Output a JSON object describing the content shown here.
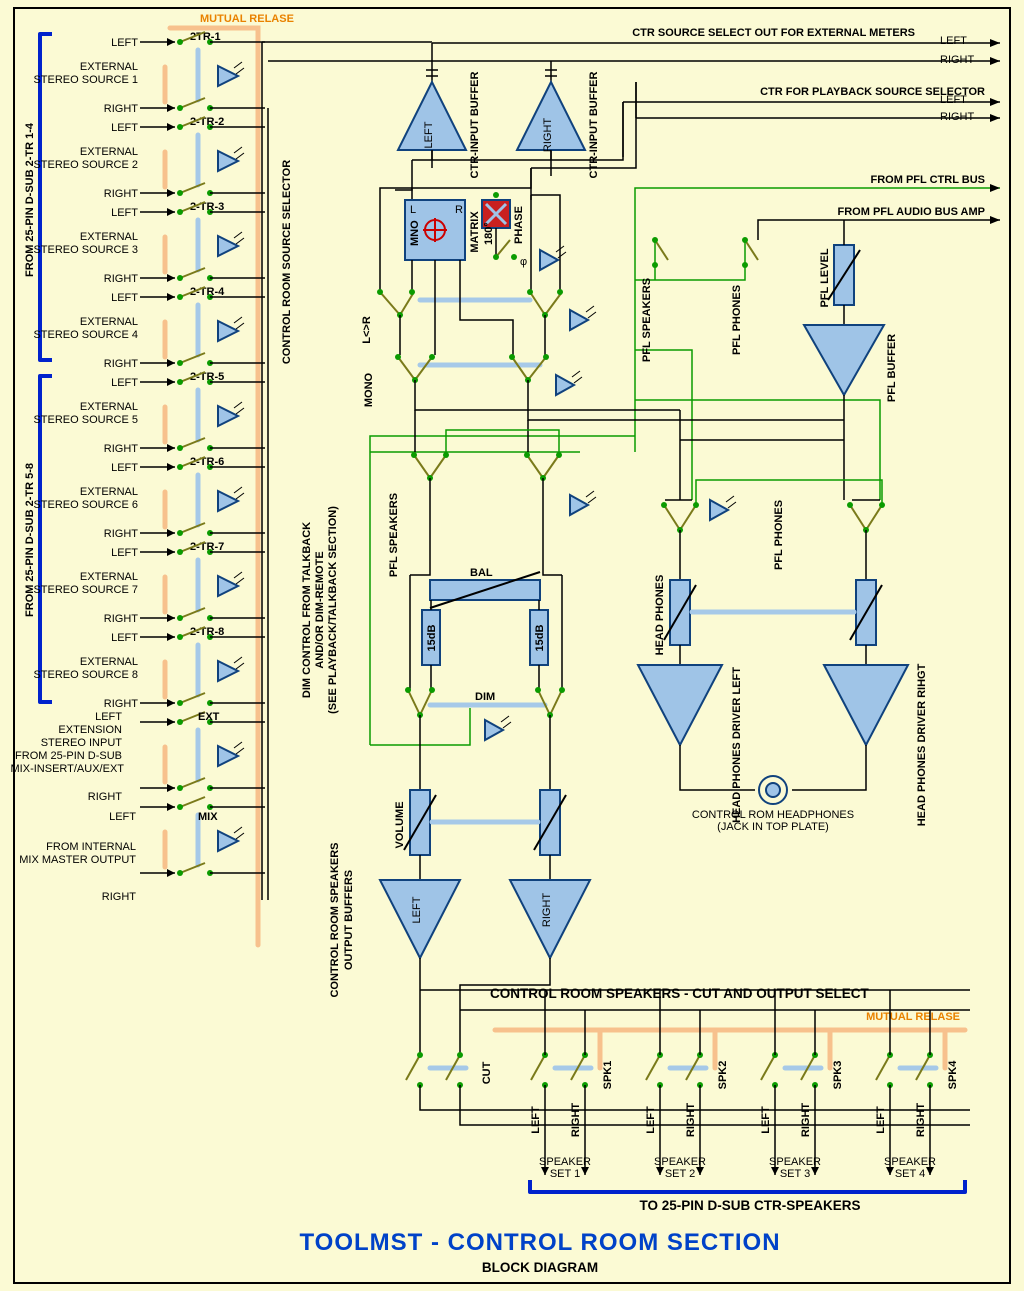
{
  "title": "TOOLMST -  CONTROL ROOM SECTION",
  "subtitle": "BLOCK DIAGRAM",
  "mutual_release_top": "MUTUAL RELASE",
  "mutual_release_bot": "MUTUAL RELASE",
  "dsub_top": "FROM 25-PIN D-SUB  2-TR 1-4",
  "dsub_bot": "FROM 25-PIN D-SUB  2-TR 5-8",
  "src_selector": "CONTROL ROOM SOURCE SELECTOR",
  "ctr_out_meters": "CTR SOURCE SELECT OUT FOR EXTERNAL METERS",
  "ctr_playback": "CTR FOR PLAYBACK SOURCE SELECTOR",
  "from_pfl_ctrl": "FROM PFL CTRL BUS",
  "from_pfl_audio": "FROM PFL AUDIO BUS AMP",
  "left": "LEFT",
  "right": "RIGHT",
  "sources": [
    {
      "tag": "2TR-1",
      "desc1": "EXTERNAL",
      "desc2": "STEREO SOURCE 1"
    },
    {
      "tag": "2-TR-2",
      "desc1": "EXTERNAL",
      "desc2": "STEREO SOURCE 2"
    },
    {
      "tag": "2-TR-3",
      "desc1": "EXTERNAL",
      "desc2": "STEREO SOURCE 3"
    },
    {
      "tag": "2-TR-4",
      "desc1": "EXTERNAL",
      "desc2": "STEREO SOURCE 4"
    },
    {
      "tag": "2-TR-5",
      "desc1": "EXTERNAL",
      "desc2": "STEREO SOURCE 5"
    },
    {
      "tag": "2-TR-6",
      "desc1": "EXTERNAL",
      "desc2": "STEREO SOURCE 6"
    },
    {
      "tag": "2-TR-7",
      "desc1": "EXTERNAL",
      "desc2": "STEREO SOURCE 7"
    },
    {
      "tag": "2-TR-8",
      "desc1": "EXTERNAL",
      "desc2": "STEREO SOURCE 8"
    }
  ],
  "ext": {
    "tag": "EXT",
    "l1": "EXTENSION",
    "l2": "STEREO INPUT",
    "l3": "FROM 25-PIN D-SUB",
    "l4": "MIX-INSERT/AUX/EXT"
  },
  "mix": {
    "tag": "MIX",
    "l1": "FROM INTERNAL",
    "l2": "MIX MASTER OUTPUT"
  },
  "ctr_input_buffer": "CTR-INPUT BUFFER",
  "ctr_input_buffer2": "CTR-INPUT BUFFER",
  "buf_left": "LEFT",
  "buf_right": "RIGHT",
  "mno": "MNO",
  "mat_L": "L",
  "mat_R": "R",
  "matrix": "MATRIX",
  "deg": "180°",
  "phase": "PHASE",
  "phi": "φ",
  "lr": "L<>R",
  "mono": "MONO",
  "pfl_speakers": "PFL SPEAKERS",
  "pfl_phones": "PFL PHONES",
  "pfl_level": "PFL LEVEL",
  "pfl_buffer": "PFL BUFFER",
  "dim_ctrl_1": "DIM CONTROL FROM TALKBACK",
  "dim_ctrl_2": "AND/OR DIM-REMOTE",
  "dim_ctrl_3": "(SEE PLAYBACK/TALKBACK SECTION)",
  "pfl_speakers2": "PFL SPEAKERS",
  "pfl_phones2": "PFL PHONES",
  "bal": "BAL",
  "db15_1": "15dB",
  "db15_2": "15dB",
  "dim": "DIM",
  "headphones": "HEAD PHONES",
  "hp_driver_left": "HEAD PHONES DRIVER LEFT",
  "hp_driver_right": "HEAD PHONES DRIVER RIHGT",
  "ctr_hp": "CONTROL ROM HEADPHONES",
  "jack": "(JACK IN TOP PLATE)",
  "volume": "VOLUME",
  "cr_buffers_1": "CONTROL ROOM SPEAKERS",
  "cr_buffers_2": "OUTPUT BUFFERS",
  "out_left": "LEFT",
  "out_right": "RIGHT",
  "cut_title": "CONTROL ROOM SPEAKERS - CUT AND OUTPUT SELECT",
  "cut": "CUT",
  "spk": [
    "SPK1",
    "SPK2",
    "SPK3",
    "SPK4"
  ],
  "spk_sets": [
    "SPEAKER SET 1",
    "SPEAKER SET 2",
    "SPEAKER SET 3",
    "SPEAKER SET 4"
  ],
  "to_dsub": "TO 25-PIN D-SUB  CTR-SPEAKERS"
}
